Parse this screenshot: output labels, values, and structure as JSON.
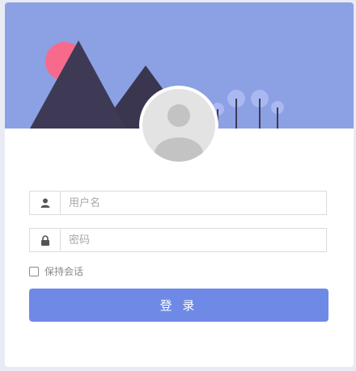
{
  "login": {
    "username_placeholder": "用户名",
    "password_placeholder": "密码",
    "remember_label": "保持会话",
    "submit_label": "登 录"
  },
  "icons": {
    "username": "user-icon",
    "password": "lock-icon",
    "avatar": "default-avatar-icon"
  },
  "colors": {
    "banner_bg": "#8ca0e4",
    "sun": "#f86a8b",
    "mountain": "#3e3a55",
    "button": "#6e8ae6"
  }
}
